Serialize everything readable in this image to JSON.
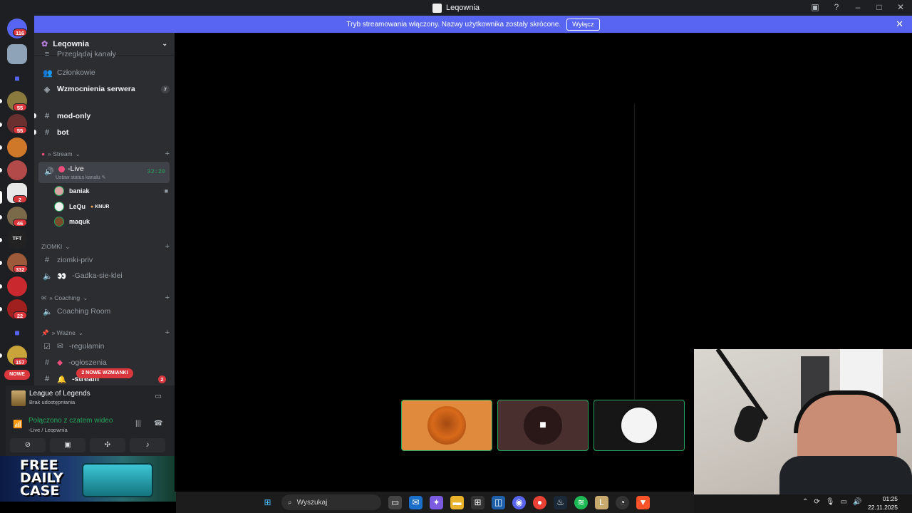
{
  "window": {
    "title": "Leqownia"
  },
  "notice": {
    "text": "Tryb streamowania włączony. Nazwy użytkownika zostały skrócone.",
    "button": "Wyłącz"
  },
  "guilds": {
    "badges": [
      "116",
      "55",
      "55",
      "2",
      "46",
      "332",
      "22",
      "157"
    ],
    "new_label": "NOWE"
  },
  "server": {
    "name": "Leqownia"
  },
  "sidebar": {
    "browse": "Przeglądaj kanały",
    "members": "Członkowie",
    "boosts": "Wzmocnienia serwera",
    "boosts_count": "7",
    "ch_modonly": "mod-only",
    "ch_bot": "bot",
    "cat_stream": "» Stream",
    "live_name": "-Live",
    "live_status": "Ustaw status kanału",
    "live_time": "32:20",
    "voice_users": [
      {
        "name": "baniak",
        "tag": ""
      },
      {
        "name": "LeQu",
        "tag": "KNUR"
      },
      {
        "name": "maquk",
        "tag": ""
      }
    ],
    "cat_ziomki": "ZIOMKI",
    "ch_ziomkipriv": "ziomki-priv",
    "ch_gadka": "-Gadka-sie-klei",
    "cat_coaching": "» Coaching",
    "ch_coachingroom": "Coaching Room",
    "cat_wazne": "» Ważne",
    "ch_regulamin": "-regulamin",
    "ch_ogloszenia": "-ogłoszenia",
    "ch_stream": "-stream",
    "mentions": "2 NOWE WZMIANKI",
    "stream_count": "2"
  },
  "activity": {
    "game": "League of Legends",
    "sub": "Brak udostępniania"
  },
  "rtc": {
    "status": "Połączono z czatem wideo",
    "channel": "-Live / Leqownia"
  },
  "ad": {
    "line1": "FREE",
    "line2": "DAILY",
    "line3": "CASE"
  },
  "taskbar": {
    "search_placeholder": "Wyszukaj"
  },
  "tray": {
    "time": "01:25",
    "date": "22.11.2025"
  },
  "colors": {
    "accent": "#5865f2",
    "online": "#23a55a",
    "danger": "#da373c"
  }
}
